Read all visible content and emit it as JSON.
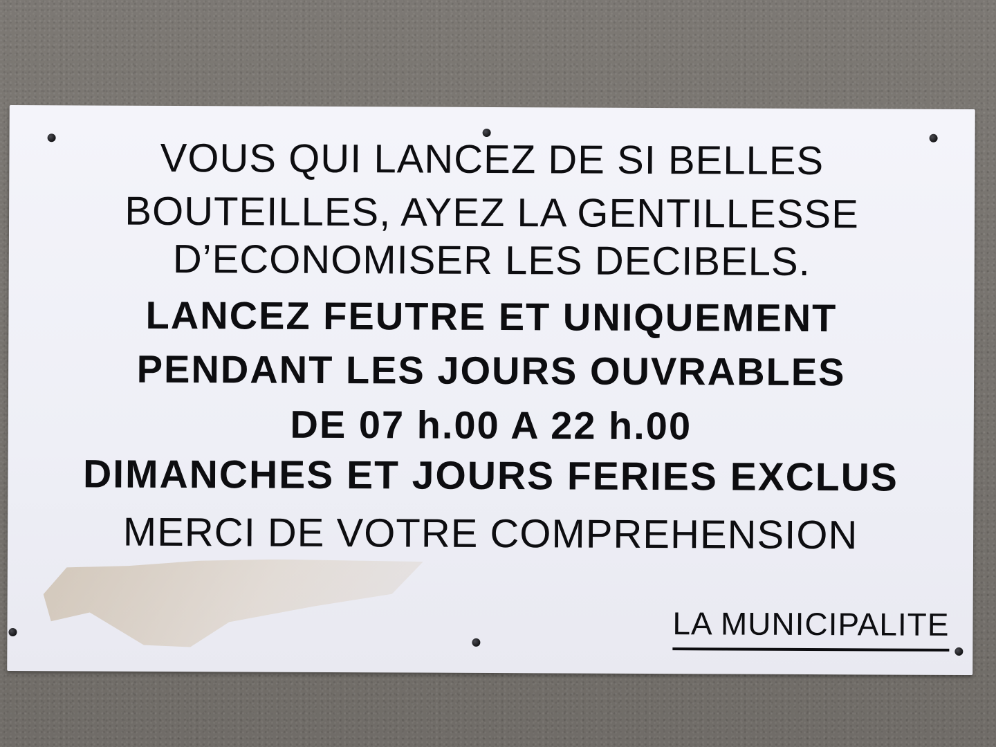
{
  "photo": {
    "subject": "sign",
    "colors": {
      "background": "#77736e",
      "sign": "#f1f1f7",
      "text": "#0d0d10"
    }
  },
  "sign": {
    "lines": [
      "VOUS QUI LANCEZ DE SI BELLES",
      "BOUTEILLES, AYEZ LA GENTILLESSE",
      "D’ECONOMISER LES DECIBELS.",
      "LANCEZ FEUTRE ET UNIQUEMENT",
      "PENDANT LES JOURS OUVRABLES",
      "DE 07 h.00 A 22 h.00",
      "DIMANCHES ET JOURS FERIES EXCLUS",
      "MERCI DE VOTRE COMPREHENSION"
    ],
    "signature": "LA MUNICIPALITE"
  }
}
